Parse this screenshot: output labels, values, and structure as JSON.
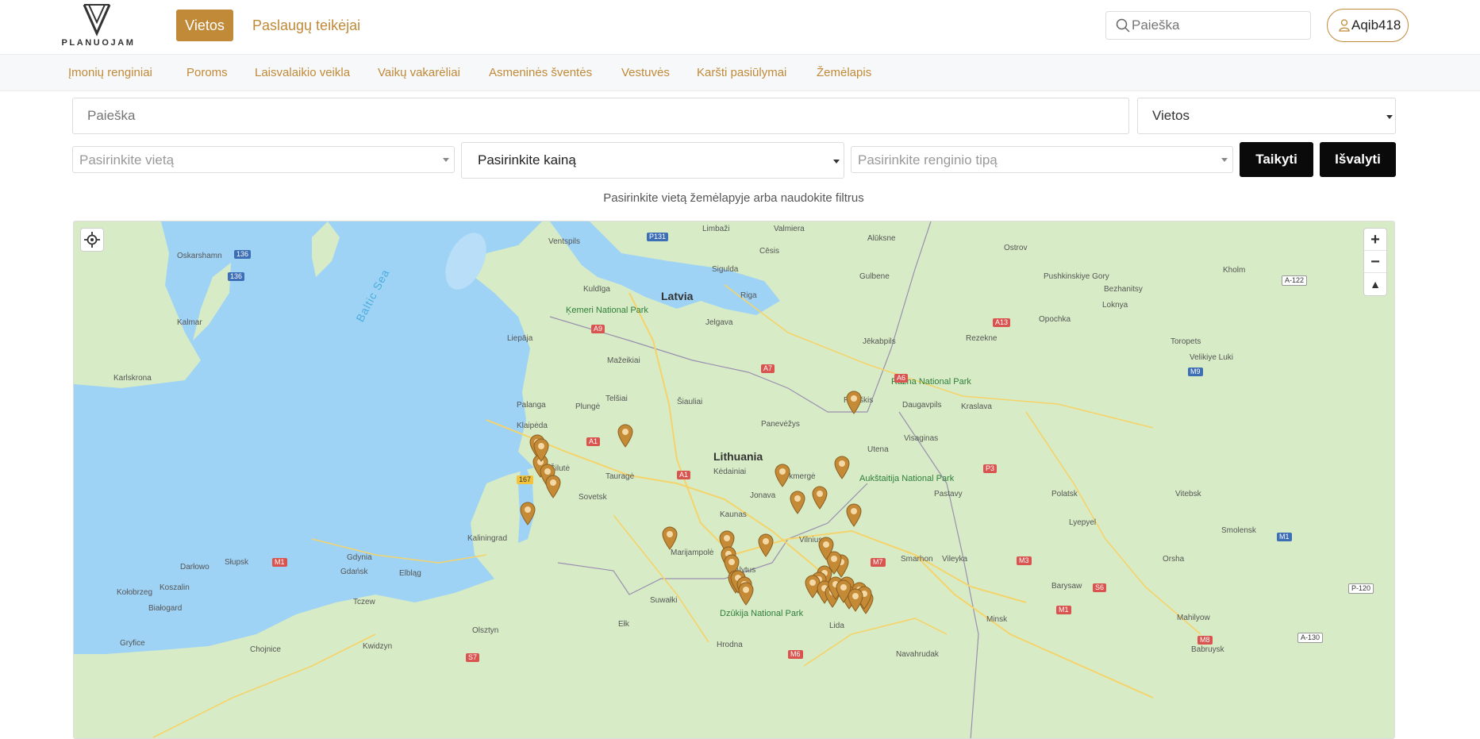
{
  "brand": {
    "name": "PLANUOJAM"
  },
  "header": {
    "nav_active": "Vietos",
    "nav_link": "Paslaugų teikėjai",
    "search_placeholder": "Paieška",
    "user_name": "Aqib418"
  },
  "categories": [
    "Įmonių renginiai",
    "Poroms",
    "Laisvalaikio veikla",
    "Vaikų vakarėliai",
    "Asmeninės šventės",
    "Vestuvės",
    "Karšti pasiūlymai",
    "Žemėlapis"
  ],
  "filters": {
    "search_placeholder": "Paieška",
    "type_value": "Vietos",
    "location_placeholder": "Pasirinkite vietą",
    "price_value": "Pasirinkite kainą",
    "event_placeholder": "Pasirinkite renginio tipą",
    "apply_label": "Taikyti",
    "clear_label": "Išvalyti",
    "hint": "Pasirinkite vietą žemėlapyje arba naudokite filtrus"
  },
  "map": {
    "zoom_in": "+",
    "zoom_out": "−",
    "compass": "▲",
    "countries": [
      "Latvia",
      "Lithuania"
    ],
    "sea": "Baltic Sea",
    "cities": [
      "Ventspils",
      "Limbaži",
      "Valmiera",
      "Alūksne",
      "Ostrov",
      "Oskarshamn",
      "Cēsis",
      "Sigulda",
      "Riga",
      "Kuldīga",
      "Gulbene",
      "Pushkinskiye Gory",
      "Bezhanitsy",
      "Kholm",
      "Kalmar",
      "Jelgava",
      "Opochka",
      "Loknya",
      "Liepāja",
      "Jēkabpils",
      "Rezekne",
      "Toropets",
      "Velikiye Luki",
      "Karlskrona",
      "Mažeikiai",
      "Rokiškis",
      "Daugavpils",
      "Kraslava",
      "Telšiai",
      "Šiauliai",
      "Plungė",
      "Palanga",
      "Klaipėda",
      "Panevėžys",
      "Utena",
      "Visaginas",
      "Šilutė",
      "Tauragė",
      "Kėdainiai",
      "Ukmergė",
      "Pastavy",
      "Polatsk",
      "Vitebsk",
      "Sovetsk",
      "Jonava",
      "Kaunas",
      "Vilnius",
      "Lyepyel",
      "Smolensk",
      "Kaliningrad",
      "Marijampolė",
      "Alytus",
      "Smarhon",
      "Vileyka",
      "Orsha",
      "Gdynia",
      "Słupsk",
      "Darłowo",
      "Gdańsk",
      "Elbląg",
      "Barysaw",
      "Koszalin",
      "Kołobrzeg",
      "Białogard",
      "Tczew",
      "Suwałki",
      "Ełk",
      "Lida",
      "Minsk",
      "Mahilyow",
      "Olsztyn",
      "Hrodna",
      "Navahrudak",
      "Kwidzyn",
      "Gryfice",
      "Chojnice",
      "Babruysk"
    ],
    "parks": [
      "Ķemeri National Park",
      "Rāzna National Park",
      "Aukštaitija National Park",
      "Dzūkija National Park"
    ],
    "roads": [
      "P131",
      "136",
      "136",
      "A9",
      "A7",
      "A6",
      "A13",
      "M9",
      "A-122",
      "A1",
      "A1",
      "167",
      "P3",
      "M1",
      "M7",
      "M3",
      "M1",
      "S6",
      "M1",
      "P-120",
      "M8",
      "A-130",
      "M6",
      "S7"
    ],
    "pin_count": 38
  },
  "colors": {
    "accent": "#c08a38",
    "pin": "#c48a35",
    "water": "#9fd3f5",
    "land": "#d7ecc6"
  }
}
